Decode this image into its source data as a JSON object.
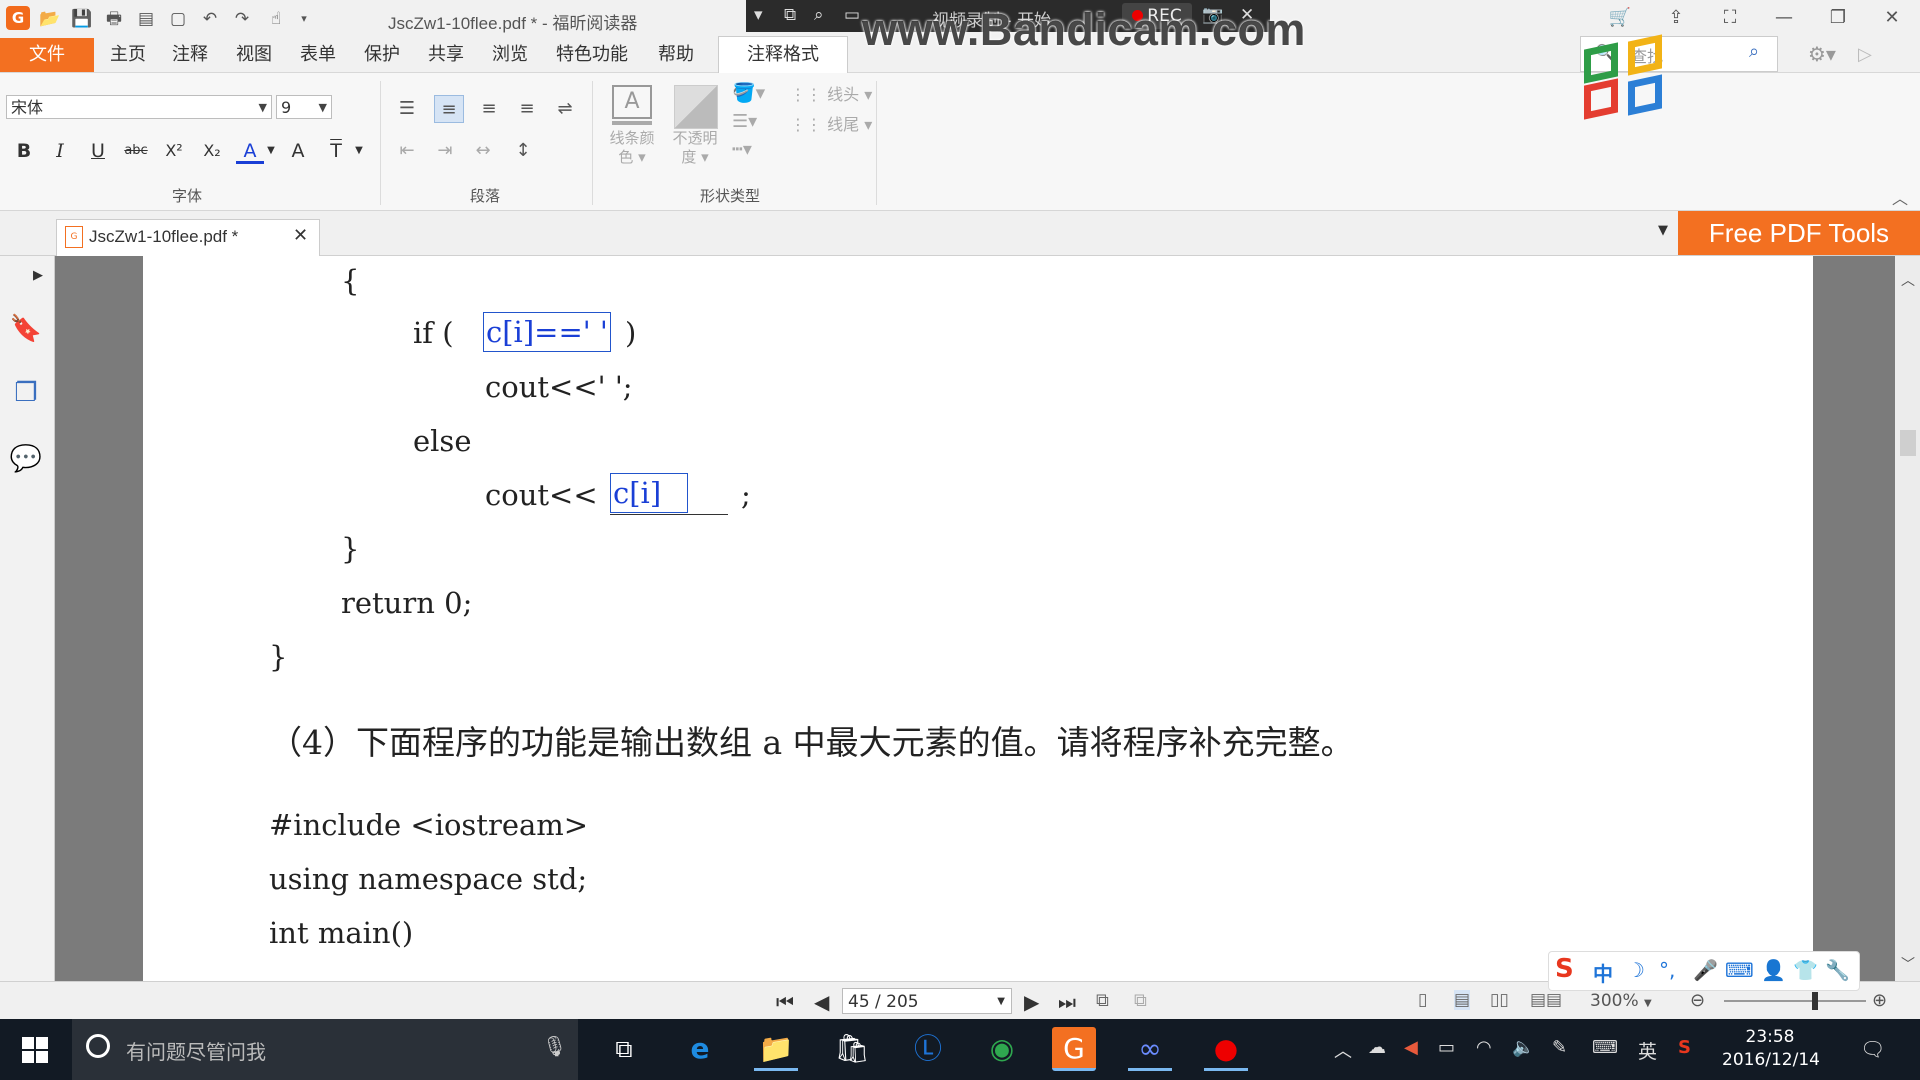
{
  "window": {
    "title": "JscZw1-10flee.pdf * - 福昕阅读器",
    "app_icon": "G"
  },
  "recording": {
    "label": "视频录制 - 开始",
    "rec_label": "REC",
    "watermark": "www.Bandicam.com"
  },
  "menu": {
    "file": "文件",
    "items": [
      "主页",
      "注释",
      "视图",
      "表单",
      "保护",
      "共享",
      "浏览",
      "特色功能",
      "帮助"
    ],
    "active_tab": "注释格式"
  },
  "search": {
    "placeholder": "查找"
  },
  "ribbon": {
    "font_name": "宋体",
    "font_size": "9",
    "groups": {
      "font": "字体",
      "paragraph": "段落",
      "shape": "形状类型"
    },
    "line_color": [
      "线条颜",
      "色"
    ],
    "opacity": [
      "不透明",
      "度"
    ],
    "line_start": "线头",
    "line_end": "线尾",
    "format_buttons": [
      "B",
      "I",
      "U",
      "abc",
      "X²",
      "X₂",
      "A",
      "A",
      "T"
    ]
  },
  "tab": {
    "label": "JscZw1-10flee.pdf *"
  },
  "promo": {
    "label": "Free PDF Tools"
  },
  "document": {
    "lines": [
      "{",
      "if (",
      ")",
      "cout<<' ';",
      "else",
      "cout<<",
      ";",
      "}",
      "return 0;",
      "}",
      "#include <iostream>",
      "using namespace std;",
      "int main()"
    ],
    "annotations": [
      "c[i]==' '",
      "c[i]"
    ],
    "question": "（4）下面程序的功能是输出数组 a 中最大元素的值。请将程序补充完整。"
  },
  "status": {
    "page": "45 / 205",
    "zoom": "300%"
  },
  "ime": {
    "mode": "中"
  },
  "taskbar": {
    "search_placeholder": "有问题尽管问我",
    "lang": "英",
    "time": "23:58",
    "date": "2016/12/14"
  },
  "colors": {
    "accent": "#f37021",
    "annotation": "#2255cc",
    "taskbar": "#121a24"
  }
}
